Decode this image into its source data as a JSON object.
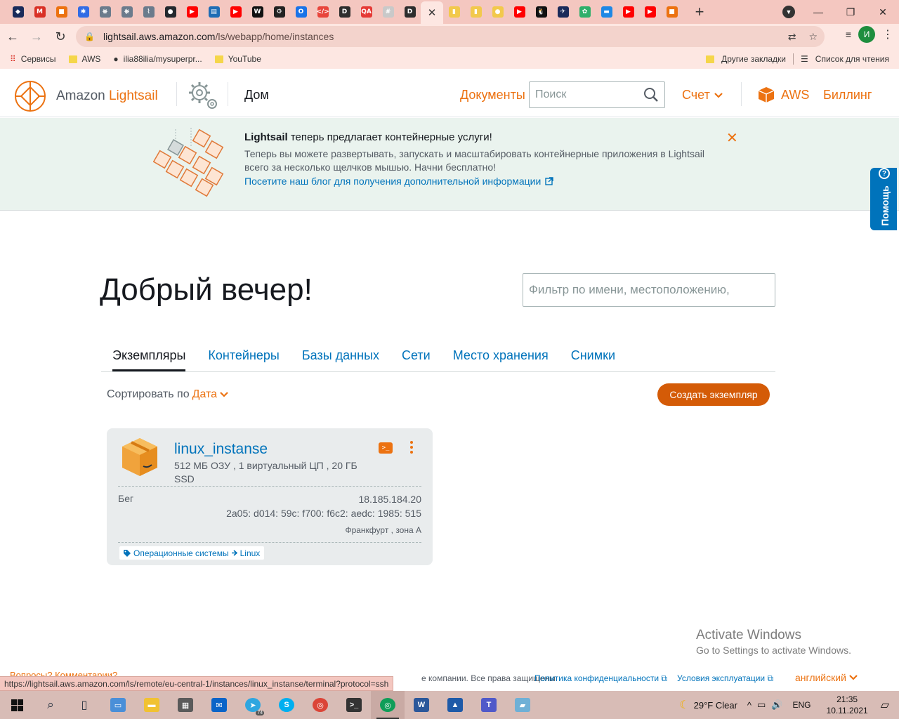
{
  "browser": {
    "tabs": [
      {
        "icon": "shield-icon",
        "color": "#1a2b5a",
        "glyph": "◆"
      },
      {
        "icon": "gmail-icon",
        "color": "#d93025",
        "glyph": "M"
      },
      {
        "icon": "lightsail-box-icon",
        "color": "#ec7211",
        "glyph": "■"
      },
      {
        "icon": "kubernetes-icon",
        "color": "#326ce5",
        "glyph": "✱"
      },
      {
        "icon": "helm-icon",
        "color": "#6b7b8c",
        "glyph": "⎈"
      },
      {
        "icon": "helm-icon",
        "color": "#6b7b8c",
        "glyph": "⎈"
      },
      {
        "icon": "clip-icon",
        "color": "#6b7b8c",
        "glyph": "⌇"
      },
      {
        "icon": "github-icon",
        "color": "#24292e",
        "glyph": "●"
      },
      {
        "icon": "youtube-icon",
        "color": "#ff0000",
        "glyph": "▶"
      },
      {
        "icon": "chart-icon",
        "color": "#1f6db5",
        "glyph": "▤"
      },
      {
        "icon": "youtube-icon",
        "color": "#ff0000",
        "glyph": "▶"
      },
      {
        "icon": "wp-icon",
        "color": "#111111",
        "glyph": "W"
      },
      {
        "icon": "wheel-icon",
        "color": "#222222",
        "glyph": "⚙"
      },
      {
        "icon": "circle-app-icon",
        "color": "#1a73e8",
        "glyph": "O"
      },
      {
        "icon": "code-icon",
        "color": "#e8453c",
        "glyph": "</>"
      },
      {
        "icon": "d-icon",
        "color": "#2d2d2d",
        "glyph": "D"
      },
      {
        "icon": "qa-icon",
        "color": "#e53935",
        "glyph": "QA"
      },
      {
        "icon": "hash-icon",
        "color": "#c9c9c9",
        "glyph": "#"
      },
      {
        "icon": "d-icon",
        "color": "#2d2d2d",
        "glyph": "D"
      },
      {
        "icon": "close-icon",
        "color": "",
        "glyph": "✕",
        "active": true
      },
      {
        "icon": "doc-icon",
        "color": "#f2c94c",
        "glyph": "▮"
      },
      {
        "icon": "doc-icon",
        "color": "#f2c94c",
        "glyph": "▮"
      },
      {
        "icon": "smile-icon",
        "color": "#f2c94c",
        "glyph": "●"
      },
      {
        "icon": "youtube-icon",
        "color": "#ff0000",
        "glyph": "▶"
      },
      {
        "icon": "linux-icon",
        "color": "#111111",
        "glyph": "🐧"
      },
      {
        "icon": "bird-icon",
        "color": "#1a2b5a",
        "glyph": "✈"
      },
      {
        "icon": "green-app-icon",
        "color": "#2eaf6a",
        "glyph": "✿"
      },
      {
        "icon": "flag-icon",
        "color": "#1e88e5",
        "glyph": "▬"
      },
      {
        "icon": "youtube-icon",
        "color": "#ff0000",
        "glyph": "▶"
      },
      {
        "icon": "youtube-icon",
        "color": "#ff0000",
        "glyph": "▶"
      },
      {
        "icon": "lightsail-box-icon",
        "color": "#ec7211",
        "glyph": "■"
      }
    ],
    "url_host": "lightsail.aws.amazon.com",
    "url_path": "/ls/webapp/home/instances",
    "profile_initial": "И",
    "bookmarks": [
      {
        "label": "Сервисы",
        "icon": "apps-grid-icon"
      },
      {
        "label": "AWS",
        "icon": "folder-icon"
      },
      {
        "label": "ilia88ilia/mysuperpr...",
        "icon": "github-icon"
      },
      {
        "label": "YouTube",
        "icon": "folder-icon"
      }
    ],
    "other_bookmarks": "Другие закладки",
    "reading_list": "Список для чтения"
  },
  "header": {
    "logo_prefix": "Amazon ",
    "logo_brand": "Lightsail",
    "home": "Дом",
    "docs": "Документы",
    "search_placeholder": "Поиск",
    "account": "Счет",
    "aws": "AWS",
    "billing": "Биллинг"
  },
  "banner": {
    "title_brand": "Lightsail",
    "title_rest": " теперь предлагает контейнерные услуги!",
    "body": "Теперь вы можете развертывать, запускать и масштабировать контейнерные приложения в Lightsail всего за несколько щелчков мышью. Начни бесплатно!",
    "link": "Посетите наш блог для получения дополнительной информации"
  },
  "help_tab": "Помощь",
  "main": {
    "greeting": "Добрый вечер!",
    "filter_placeholder": "Фильтр по имени, местоположению,",
    "tabs": [
      "Экземпляры",
      "Контейнеры",
      "Базы данных",
      "Сети",
      "Место хранения",
      "Снимки"
    ],
    "sort_label": "Сортировать по",
    "sort_value": "Дата",
    "create_button": "Создать экземпляр"
  },
  "instance": {
    "name": "linux_instanse",
    "spec": "512 МБ ОЗУ , 1 виртуальный ЦП , 20 ГБ SSD",
    "state": "Бег",
    "ipv4": "18.185.184.20",
    "ipv6": "2a05: d014: 59c: f700: f6c2: aedc: 1985: 515",
    "zone": "Франкфурт , зона А",
    "tag_key": "Операционные системы",
    "tag_value": "Linux"
  },
  "watermark": {
    "line1": "Activate Windows",
    "line2": "Go to Settings to activate Windows."
  },
  "footer": {
    "feedback": "Вопросы? Комментарии?",
    "copyright": "е компании. Все права защищены.",
    "privacy": "Политика конфиденциальности",
    "terms": "Условия эксплуатации",
    "language": "английский"
  },
  "status_url": "https://lightsail.aws.amazon.com/ls/remote/eu-central-1/instances/linux_instanse/terminal?protocol=ssh",
  "taskbar": {
    "weather": "29°F  Clear",
    "lang": "ENG",
    "time": "21:35",
    "date": "10.11.2021",
    "telegram_badge": "74"
  }
}
